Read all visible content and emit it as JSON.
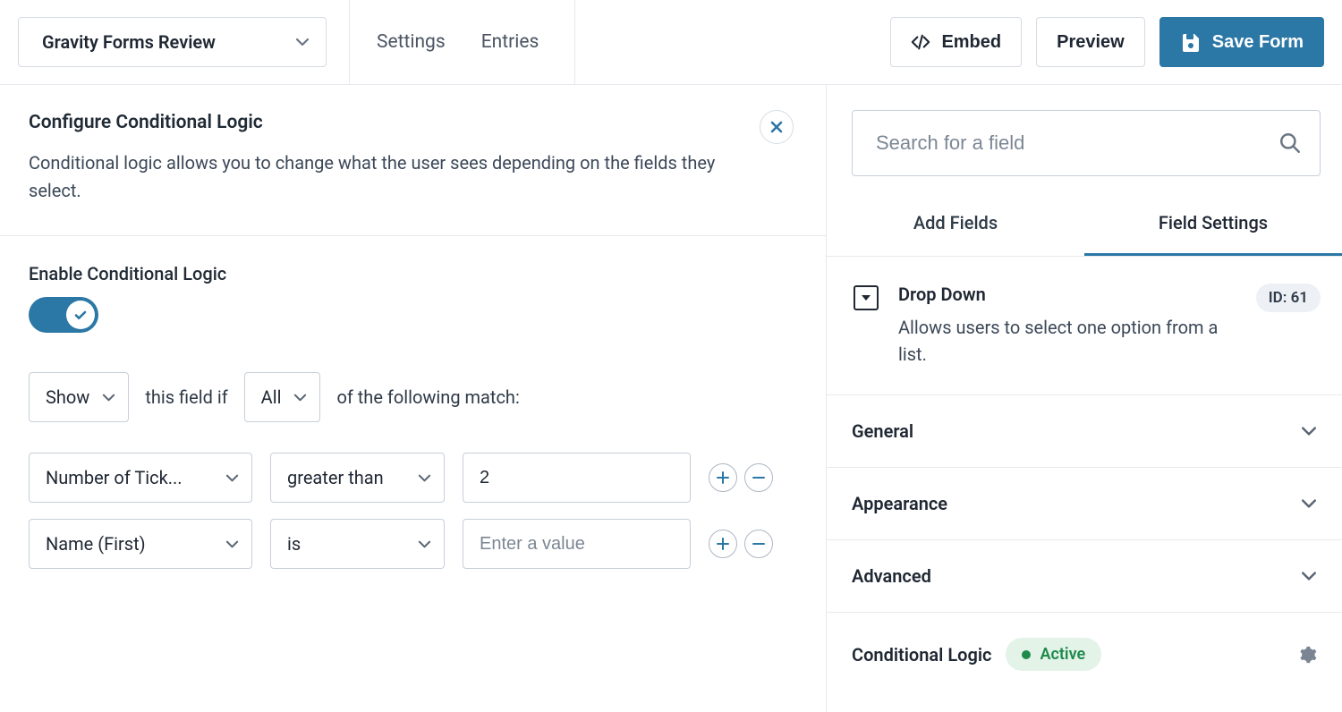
{
  "topbar": {
    "form_name": "Gravity Forms Review",
    "tabs": {
      "settings": "Settings",
      "entries": "Entries"
    },
    "embed": "Embed",
    "preview": "Preview",
    "save": "Save Form"
  },
  "left": {
    "header_title": "Configure Conditional Logic",
    "header_desc": "Conditional logic allows you to change what the user sees depending on the fields they select.",
    "enable_label": "Enable Conditional Logic",
    "sentence": {
      "action": "Show",
      "mid1": "this field if",
      "match": "All",
      "mid2": "of the following match:"
    },
    "rules": [
      {
        "field": "Number of Tick...",
        "op": "greater than",
        "value": "2",
        "placeholder": "Enter a value"
      },
      {
        "field": "Name (First)",
        "op": "is",
        "value": "",
        "placeholder": "Enter a value"
      }
    ]
  },
  "right": {
    "search_placeholder": "Search for a field",
    "tabs": {
      "add": "Add Fields",
      "settings": "Field Settings"
    },
    "field": {
      "title": "Drop Down",
      "desc": "Allows users to select one option from a list.",
      "id_label": "ID: 61"
    },
    "accordion": {
      "general": "General",
      "appearance": "Appearance",
      "advanced": "Advanced",
      "conditional": "Conditional Logic",
      "active_label": "Active"
    }
  }
}
